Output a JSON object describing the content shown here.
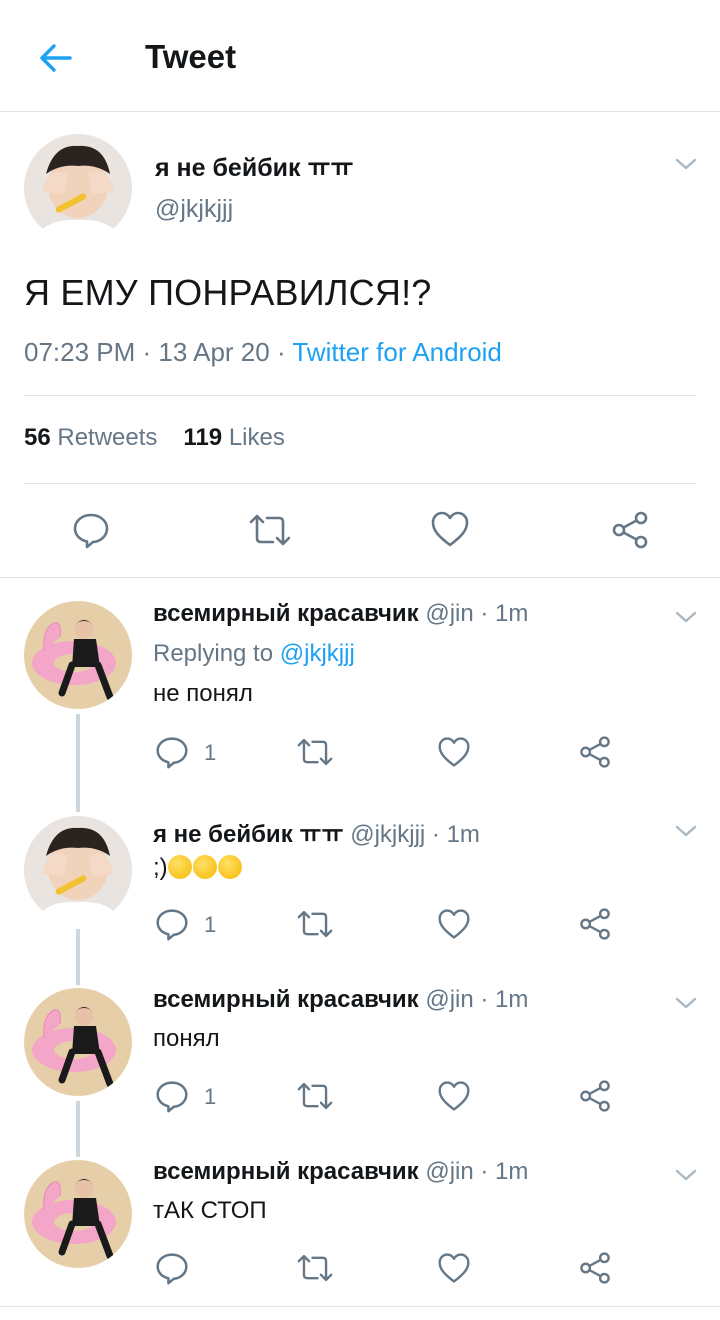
{
  "header": {
    "title": "Tweet"
  },
  "main_tweet": {
    "author_name": "я не бейбик ㅠㅠ",
    "author_handle": "@jkjkjjj",
    "text": "Я ЕМУ ПОНРАВИЛСЯ!?",
    "time": "07:23 PM",
    "date": "13 Apr 20",
    "separator": " · ",
    "source": "Twitter for Android",
    "retweets_count": "56",
    "retweets_label": "Retweets",
    "likes_count": "119",
    "likes_label": "Likes"
  },
  "replies": [
    {
      "name": "всемирный красавчик",
      "handle": "@jin",
      "time": "1m",
      "replying_prefix": "Replying to",
      "replying_to": "@jkjkjjj",
      "text": "не понял",
      "reply_count": "1"
    },
    {
      "name": "я не бейбик ㅠㅠ",
      "handle": "@jkjkjjj",
      "time": "1m",
      "text": ";)",
      "emoji": "kissing-face-with-closed-eyes",
      "reply_count": "1"
    },
    {
      "name": "всемирный красавчик",
      "handle": "@jin",
      "time": "1m",
      "text": "понял",
      "reply_count": "1"
    },
    {
      "name": "всемирный красавчик",
      "handle": "@jin",
      "time": "1m",
      "text": "тАК СТОП",
      "reply_count": ""
    }
  ],
  "colors": {
    "accent": "#1da1f2",
    "text_primary": "#14171a",
    "text_secondary": "#657786",
    "divider": "#dfe3e6",
    "thread_line": "#ccd6dd"
  }
}
